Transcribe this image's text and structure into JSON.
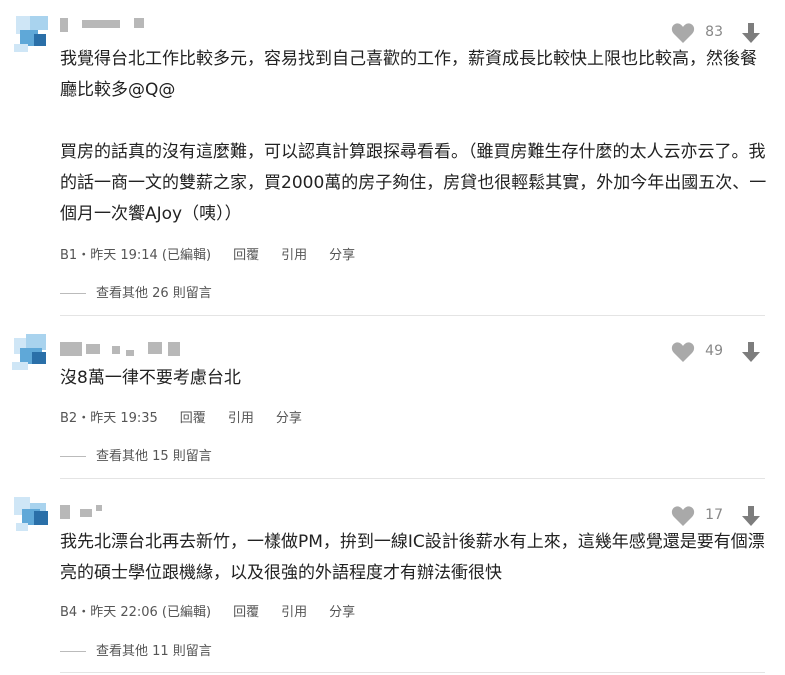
{
  "comments": [
    {
      "likes": "83",
      "body": "我覺得台北工作比較多元，容易找到自己喜歡的工作，薪資成長比較快上限也比較高，然後餐廳比較多@Q@\n\n買房的話真的沒有這麼難，可以認真計算跟探尋看看。（雖買房難生存什麼的太人云亦云了。我的話一商一文的雙薪之家，買2000萬的房子夠住，房貸也很輕鬆其實，外加今年出國五次、一個月一次饗AJoy（咦））",
      "floor_time": "B1・昨天 19:14 (已編輯)",
      "reply": "回覆",
      "quote": "引用",
      "share": "分享",
      "more_replies": "查看其他 26 則留言"
    },
    {
      "likes": "49",
      "body": "沒8萬一律不要考慮台北",
      "floor_time": "B2・昨天 19:35",
      "reply": "回覆",
      "quote": "引用",
      "share": "分享",
      "more_replies": "查看其他 15 則留言"
    },
    {
      "likes": "17",
      "body": "我先北漂台北再去新竹，一樣做PM，拚到一線IC設計後薪水有上來，這幾年感覺還是要有個漂亮的碩士學位跟機緣，以及很強的外語程度才有辦法衝很快",
      "floor_time": "B4・昨天 22:06 (已編輯)",
      "reply": "回覆",
      "quote": "引用",
      "share": "分享",
      "more_replies": "查看其他 11 則留言"
    }
  ],
  "colors": {
    "avatar_light": "#a9d3ee",
    "avatar_mid": "#5fa8d8",
    "avatar_dark": "#2a6fa8",
    "icon_gray": "#a9a9a9",
    "arrow_gray": "#7d7d7d"
  }
}
